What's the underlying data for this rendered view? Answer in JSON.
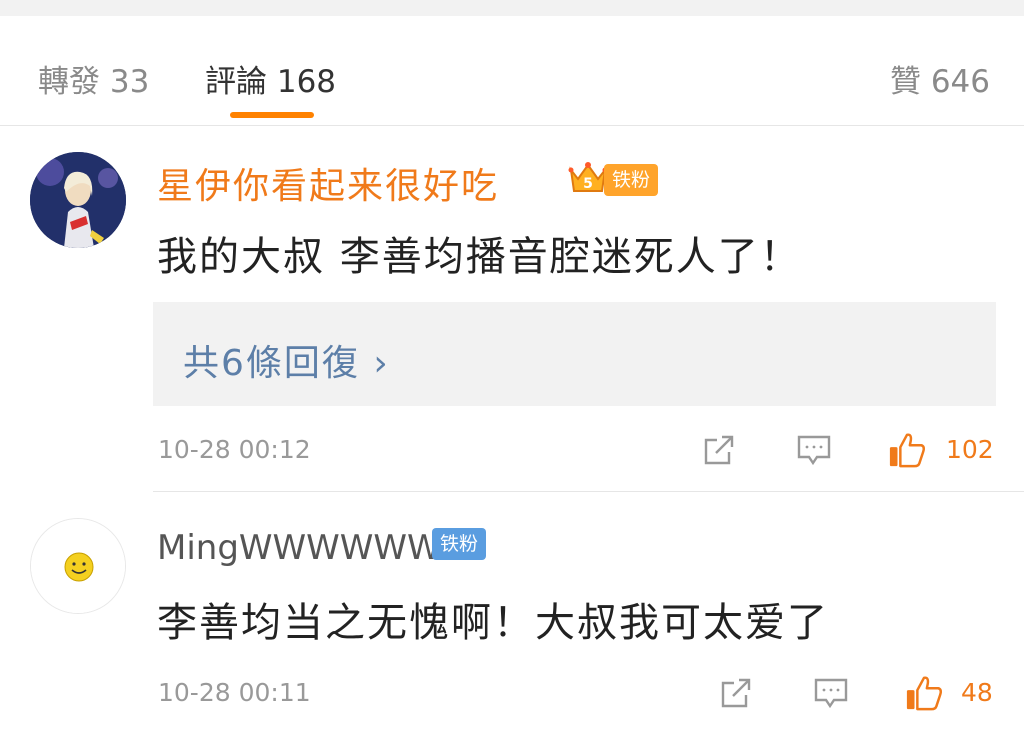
{
  "tabs": {
    "forward_label": "轉發 33",
    "comments_label": "評論 168",
    "likes_label": "贊 646"
  },
  "comments": [
    {
      "username": "星伊你看起来很好吃",
      "badge_level": "5",
      "badge_label": "铁粉",
      "text": "我的大叔 李善均播音腔迷死人了！",
      "replies_link": "共6條回復 ›",
      "timestamp": "10-28 00:12",
      "likes": "102"
    },
    {
      "username": "MingWWWWWWW",
      "badge_label": "铁粉",
      "text": "李善均当之无愧啊！大叔我可太爱了",
      "timestamp": "10-28 00:11",
      "likes": "48"
    }
  ],
  "colors": {
    "accent": "#ff8200",
    "username_highlight": "#f07a1a",
    "link": "#5d7fa8",
    "fan_badge_gold": "#ffa42b",
    "fan_badge_blue": "#5a9de0"
  }
}
